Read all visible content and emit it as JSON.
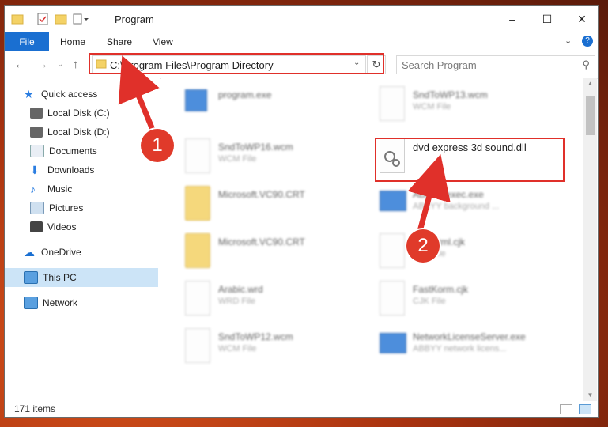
{
  "window": {
    "title": "Program",
    "controls": {
      "minimize": "–",
      "maximize": "☐",
      "close": "✕"
    }
  },
  "ribbon": {
    "tabs": [
      "File",
      "Home",
      "Share",
      "View"
    ],
    "expand_glyph": "⌄",
    "help_glyph": "?"
  },
  "address": {
    "path": "C:\\Program Files\\Program Directory",
    "search_placeholder": "Search Program"
  },
  "sidebar": {
    "items": [
      {
        "label": "Quick access"
      },
      {
        "label": "Local Disk (C:)"
      },
      {
        "label": "Local Disk (D:)"
      },
      {
        "label": "Documents"
      },
      {
        "label": "Downloads"
      },
      {
        "label": "Music"
      },
      {
        "label": "Pictures"
      },
      {
        "label": "Videos"
      },
      {
        "label": "OneDrive"
      },
      {
        "label": "This PC"
      },
      {
        "label": "Network"
      }
    ]
  },
  "files": [
    {
      "name": "program.exe",
      "sub": ""
    },
    {
      "name": "SndToWP13.wcm",
      "sub": "WCM File"
    },
    {
      "name": "SndToWP16.wcm",
      "sub": "WCM File"
    },
    {
      "name": "dvd express 3d sound.dll",
      "sub": ""
    },
    {
      "name": "Microsoft.VC90.CRT",
      "sub": ""
    },
    {
      "name": "ABBYY.exec.exe",
      "sub": "ABBYY background ..."
    },
    {
      "name": "Microsoft.VC90.CRT",
      "sub": ""
    },
    {
      "name": "FastHtml.cjk",
      "sub": "CJK File"
    },
    {
      "name": "Arabic.wrd",
      "sub": "WRD File"
    },
    {
      "name": "FastKorm.cjk",
      "sub": "CJK File"
    },
    {
      "name": "SndToWP12.wcm",
      "sub": "WCM File"
    },
    {
      "name": "NetworkLicenseServer.exe",
      "sub": "ABBYY network licens..."
    }
  ],
  "status": {
    "item_count": "171 items"
  },
  "callouts": {
    "one": "1",
    "two": "2",
    "color": "#e0302a"
  }
}
